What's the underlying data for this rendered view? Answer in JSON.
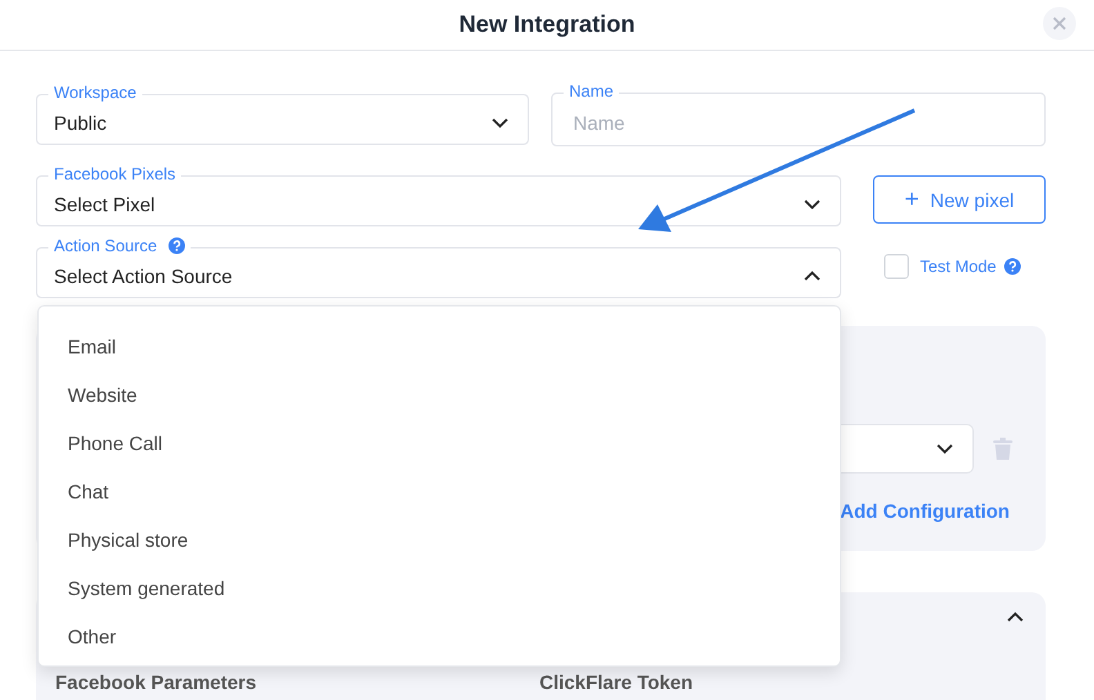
{
  "dialog": {
    "title": "New Integration"
  },
  "fields": {
    "workspace": {
      "label": "Workspace",
      "value": "Public"
    },
    "name": {
      "label": "Name",
      "placeholder": "Name"
    },
    "pixels": {
      "label": "Facebook Pixels",
      "value": "Select Pixel"
    },
    "action_source": {
      "label": "Action Source",
      "value": "Select Action Source",
      "expanded": true
    }
  },
  "new_pixel_button": {
    "icon": "+",
    "label": "New pixel"
  },
  "test_mode": {
    "label": "Test Mode",
    "checked": false
  },
  "action_source_options": [
    {
      "label": "Email"
    },
    {
      "label": "Website"
    },
    {
      "label": "Phone Call"
    },
    {
      "label": "Chat"
    },
    {
      "label": "Physical store"
    },
    {
      "label": "System generated"
    },
    {
      "label": "Other"
    }
  ],
  "configuration_panel": {
    "add_button": "Add Configuration"
  },
  "parameters_panel": {
    "expanded": true,
    "column_1": "Facebook Parameters",
    "column_2": "ClickFlare Token"
  }
}
